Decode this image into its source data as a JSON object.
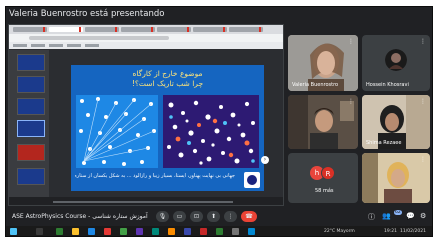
{
  "meeting": {
    "banner_text": "Valeria Buenrostro está presentando",
    "course_label": "ASE AstroPhysics Course - آموزش ستاره شناسی"
  },
  "slide": {
    "title_line1": "موضوع خارج از کارگاه",
    "title_line2": "چرا شب تاریک است؟!",
    "caption": "جهانی بی نهایت پهناور، ایستا، بسیار زیبا و رازآلود ... به شکل یکسان از ستاره پر شده است",
    "arrow_glyph": "›"
  },
  "participants": [
    {
      "name": "Valeria Buenrostro",
      "color": "#b5b0a9",
      "skin": "#c9a38a"
    },
    {
      "name": "Hossein Khosravi",
      "color": "#3c4043",
      "skin": "#3c4043"
    },
    {
      "name": "",
      "color": "#5a4f45",
      "skin": "#c59a7d"
    },
    {
      "name": "Shima Rezaee",
      "color": "#d2c6b4",
      "skin": "#b78b70"
    },
    {
      "name": "58 más",
      "color": "#3c4043",
      "skin": "#3c4043"
    },
    {
      "name": "",
      "color": "#c8b593",
      "skin": "#d4a988"
    }
  ],
  "more_avatars": {
    "letters": [
      "h",
      "R"
    ],
    "colors": [
      "#e8453c",
      "#d93025"
    ]
  },
  "controls": {
    "mic_icon": "🎙",
    "camera_icon": "▭",
    "captions_icon": "⊡",
    "present_icon": "⬆",
    "more_icon": "⋮",
    "hangup_icon": "☎",
    "info_icon": "ⓘ",
    "people_icon": "👥",
    "people_count": "62",
    "chat_icon": "💬",
    "activities_icon": "⚙"
  },
  "taskbar": {
    "time": "19:21",
    "date": "11/02/2021",
    "weather": "22°C Mayorm"
  },
  "colors": {
    "frame_bg": "#202124",
    "slide_bg": "#1565c0",
    "slide_title": "#ffe57a",
    "hangup": "#ea4335"
  }
}
